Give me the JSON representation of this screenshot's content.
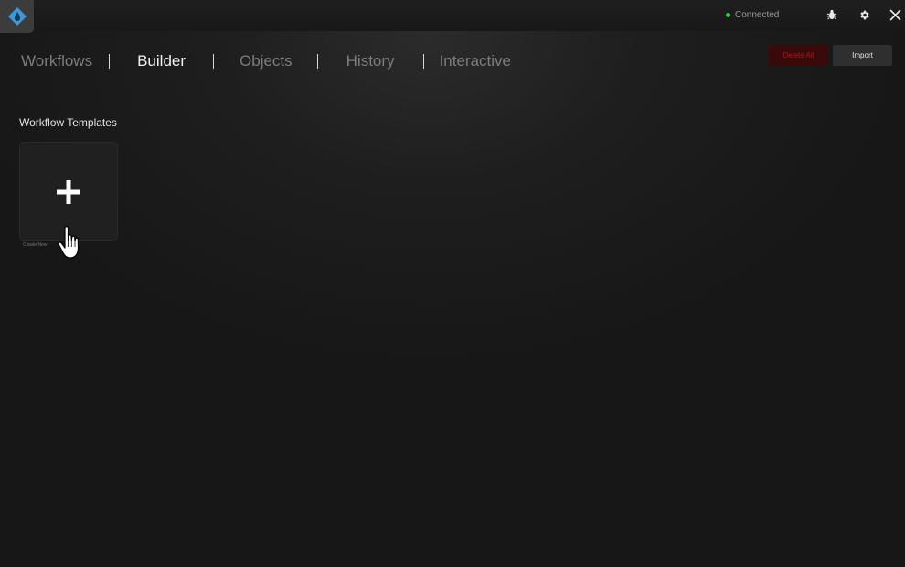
{
  "titlebar": {
    "status_text": "Connected",
    "status_color": "#2ecc40",
    "icons": [
      "logo-icon",
      "bug-icon",
      "gear-icon",
      "close-icon"
    ]
  },
  "nav": {
    "tabs": [
      "Workflows",
      "Builder",
      "Objects",
      "History",
      "Interactive"
    ],
    "active": "Builder"
  },
  "actions": {
    "delete_all_label": "Delete All",
    "import_label": "Import"
  },
  "templates": {
    "heading": "Workflow Templates",
    "create_caption": "Create New"
  },
  "colors": {
    "logo_accent": "#3a9ad9",
    "delete_text": "#b01818",
    "delete_bg": "#3a0a0a"
  }
}
